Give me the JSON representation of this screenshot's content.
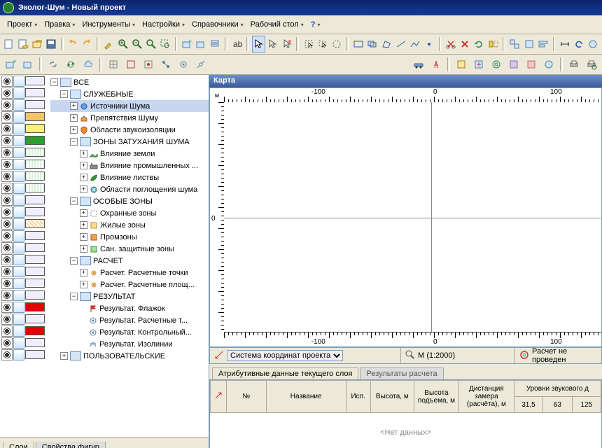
{
  "title": "Эколог-Шум - Новый проект",
  "menu": [
    "Проект",
    "Правка",
    "Инструменты",
    "Настройки",
    "Справочники",
    "Рабочий стол",
    "?"
  ],
  "map_title": "Карта",
  "ruler_unit": "м",
  "axis_labels": [
    "-100",
    "0",
    "100"
  ],
  "crs_label": "Система координат проекта",
  "scale_label": "М (1:2000)",
  "calc_status": "Расчет не проведен",
  "attr_tabs": [
    "Атрибутивные данные текущего слоя",
    "Результаты расчета"
  ],
  "grid": {
    "group_header": "Уровни звукового д",
    "cols": [
      "№",
      "Название",
      "Исп.",
      "Высота, м",
      "Высота подъема, м",
      "Дистанция замера (расчёта), м",
      "31,5",
      "63",
      "125"
    ],
    "nodata": "<Нет данных>"
  },
  "left_tabs": [
    "Слои",
    "Свойства фигур"
  ],
  "tree": [
    {
      "d": 0,
      "pm": "-",
      "t": "folder",
      "label": "ВСЕ",
      "sw": "#eef"
    },
    {
      "d": 1,
      "pm": "-",
      "t": "folder",
      "label": "СЛУЖЕБНЫЕ",
      "sw": "#eef"
    },
    {
      "d": 2,
      "pm": "+",
      "t": "node",
      "label": "Источники Шума",
      "sel": true,
      "sw": "#eef",
      "ic": "speaker"
    },
    {
      "d": 2,
      "pm": "+",
      "t": "node",
      "label": "Препятствия Шуму",
      "sw": "#f2c36b",
      "ic": "house"
    },
    {
      "d": 2,
      "pm": "+",
      "t": "node",
      "label": "Области звукоизоляции",
      "sw": "#f9f07a",
      "ic": "shield"
    },
    {
      "d": 2,
      "pm": "-",
      "t": "folder",
      "label": "ЗОНЫ ЗАТУХАНИЯ ШУМА",
      "sw": "#2e9e2e"
    },
    {
      "d": 3,
      "pm": "+",
      "t": "node",
      "label": "Влияние земли",
      "sw": "#d8f2d8",
      "hatch": 1,
      "ic": "hill"
    },
    {
      "d": 3,
      "pm": "+",
      "t": "node",
      "label": "Влияние промышленных ...",
      "sw": "#d8f2d8",
      "hatch": 1,
      "ic": "factory"
    },
    {
      "d": 3,
      "pm": "+",
      "t": "node",
      "label": "Влияние листвы",
      "sw": "#d8f2d8",
      "hatch": 1,
      "ic": "leaf"
    },
    {
      "d": 3,
      "pm": "+",
      "t": "node",
      "label": "Области поглощения шума",
      "sw": "#d8f2d8",
      "hatch": 1,
      "ic": "absorb"
    },
    {
      "d": 2,
      "pm": "-",
      "t": "folder",
      "label": "ОСОБЫЕ ЗОНЫ",
      "sw": "#eef"
    },
    {
      "d": 3,
      "pm": "+",
      "t": "node",
      "label": "Охранные зоны",
      "sw": "#eef",
      "ic": "zone"
    },
    {
      "d": 3,
      "pm": "+",
      "t": "node",
      "label": "Жилые зоны",
      "sw": "#f5d39a",
      "hatch": 2,
      "ic": "zone-y"
    },
    {
      "d": 3,
      "pm": "+",
      "t": "node",
      "label": "Промзоны",
      "sw": "#eef",
      "ic": "zone-o"
    },
    {
      "d": 3,
      "pm": "+",
      "t": "node",
      "label": "Сан. защитные зоны",
      "sw": "#eef",
      "ic": "zone-g"
    },
    {
      "d": 2,
      "pm": "-",
      "t": "folder",
      "label": "РАСЧЕТ",
      "sw": "#eef"
    },
    {
      "d": 3,
      "pm": "+",
      "t": "node",
      "label": "Расчет. Расчетные точки",
      "sw": "#eef",
      "ic": "ptc"
    },
    {
      "d": 3,
      "pm": "+",
      "t": "node",
      "label": "Расчет. Расчетные площ...",
      "sw": "#eef",
      "ic": "ptc"
    },
    {
      "d": 2,
      "pm": "-",
      "t": "folder",
      "label": "РЕЗУЛЬТАТ",
      "sw": "#eef"
    },
    {
      "d": 3,
      "pm": " ",
      "t": "node",
      "label": "Результат. Флажок",
      "sw": "#e40000",
      "ic": "flag"
    },
    {
      "d": 3,
      "pm": " ",
      "t": "node",
      "label": "Результат. Расчетные т...",
      "sw": "#eef",
      "ic": "res"
    },
    {
      "d": 3,
      "pm": " ",
      "t": "node",
      "label": "Результат. Контрольный...",
      "sw": "#e40000",
      "ic": "res"
    },
    {
      "d": 3,
      "pm": " ",
      "t": "node",
      "label": "Результат. Изолинии",
      "sw": "#eef",
      "ic": "iso"
    },
    {
      "d": 1,
      "pm": "+",
      "t": "folder",
      "label": "ПОЛЬЗОВАТЕЛЬСКИЕ",
      "sw": "#eef"
    }
  ]
}
